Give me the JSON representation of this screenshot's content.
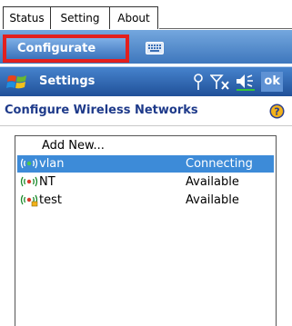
{
  "tabs": [
    {
      "label": "Status"
    },
    {
      "label": "Setting"
    },
    {
      "label": "About"
    }
  ],
  "toolbar": {
    "configure_label": "Configurate",
    "keyboard_icon": "keyboard-icon"
  },
  "title_bar": {
    "title": "Settings",
    "ok_label": "ok",
    "icons": [
      "windows-flag-icon",
      "antenna-icon",
      "signal-off-icon",
      "speaker-icon"
    ]
  },
  "header": {
    "title": "Configure Wireless Networks",
    "help_icon": "help-icon"
  },
  "networks": {
    "add_new": "Add New...",
    "items": [
      {
        "name": "vlan",
        "status": "Connecting",
        "selected": true
      },
      {
        "name": "NT",
        "status": "Available",
        "selected": false
      },
      {
        "name": "test",
        "status": "Available",
        "selected": false
      }
    ]
  },
  "colors": {
    "accent_blue": "#3d8bd8",
    "highlight_red": "#e3201e",
    "header_text": "#1e3a8a"
  }
}
